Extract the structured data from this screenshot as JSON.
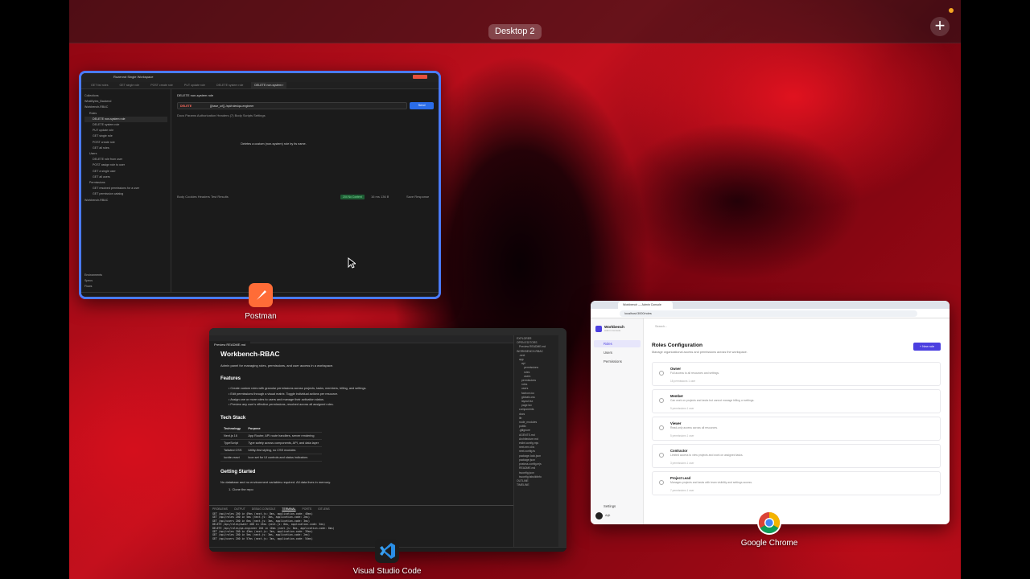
{
  "desktop": {
    "space_label": "Desktop 2",
    "add_space": "+"
  },
  "postman": {
    "app_label": "Postman",
    "workspace": "Rozenrot Single Workspace",
    "tabs": [
      "GET list roles",
      "GET single role",
      "POST create role",
      "PUT update role",
      "DELETE system role",
      "DELETE non-system r"
    ],
    "sidebar": [
      "Collections",
      "WhatBytes_Backend",
      "Workbench-RBAC",
      "Roles",
      "DELETE non-system role",
      "DELETE system role",
      "PUT update role",
      "GET single role",
      "POST create role",
      "GET all roles",
      "Users",
      "DELETE role from user",
      "POST assign role to user",
      "GET a single user",
      "GET all users",
      "Permissions",
      "GET resolved permissions for a user",
      "GET permission catalog",
      "Workbench-RBAC"
    ],
    "sidebar_bottom": [
      "Environments",
      "Specs",
      "Flows"
    ],
    "request_title": "DELETE non-system role",
    "method": "DELETE",
    "url": "{{base_url}} /api/roles/qa-engineer",
    "send": "Send",
    "req_tabs": "Docs  Params  Authorization  Headers (7)  Body  Scripts  Settings",
    "description": "Deletes a custom (non-system) role by its name.",
    "resp_tabs": "Body  Cookies  Headers  Test Results",
    "status": "204 No Content",
    "resp_meta": "16 ms   136 B",
    "save_resp": "Save Response"
  },
  "vscode": {
    "app_label": "Visual Studio Code",
    "tab": "Preview README.md",
    "title": "Workbench-RBAC",
    "intro": "Admin panel for managing roles, permissions, and user access in a workspace.",
    "features_h": "Features",
    "features": [
      "Create custom roles with granular permissions across projects, tasks, members, billing, and settings.",
      "Edit permissions through a visual matrix. Toggle individual actions per resource.",
      "Assign one or more roles to users and manage their activation status.",
      "Preview any user's effective permissions, resolved across all assigned roles."
    ],
    "stack_h": "Tech Stack",
    "stack_cols": [
      "Technology",
      "Purpose"
    ],
    "stack_rows": [
      [
        "Next.js 16",
        "App Router, API route handlers, server rendering"
      ],
      [
        "TypeScript",
        "Type safety across components, API, and data layer"
      ],
      [
        "Tailwind CSS",
        "Utility-first styling, no CSS modules"
      ],
      [
        "lucide-react",
        "Icon set for UI controls and status indicators"
      ]
    ],
    "getting_h": "Getting Started",
    "getting_p": "No database and no environment variables required. All data lives in memory.",
    "step1": "1. Clone the repo",
    "terminal_tabs": [
      "PROBLEMS",
      "OUTPUT",
      "DEBUG CONSOLE",
      "TERMINAL",
      "PORTS",
      "GITLENS"
    ],
    "terminal_lines": [
      "GET /api/roles 200 in 49ms (next.js: 8ms, application-code: 40ms)",
      "GET /api/roles 200 in 5ms (next.js: 3ms, application-code: 2ms)",
      "GET /api/users 200 in 6ms (next.js: 3ms, application-code: 3ms)",
      "DELETE /api/roles/owner 400 in 13ms (next.js: 8ms, application-code: 5ms)",
      "DELETE /api/roles/qa-engineer 204 in 16ms (next.js: 8ms, application-code: 8ms)",
      "GET /api/roles 200 in 43ms (next.js: 3ms, application-code: 39ms)",
      "GET /api/roles 200 in 5ms (next.js: 3ms, application-code: 2ms)",
      "GET /api/users 200 in 57ms (next.js: 3ms, application-code: 54ms)"
    ],
    "explorer": [
      "EXPLORER",
      "OPEN EDITORS",
      "Preview README.md",
      "WORKBENCH-RBAC",
      ".next",
      "app",
      "api",
      "permissions",
      "roles",
      "users",
      "permissions",
      "roles",
      "users",
      "favicon.ico",
      "globals.css",
      "layout.tsx",
      "page.tsx",
      "components",
      "docs",
      "lib",
      "node_modules",
      "public",
      ".gitignore",
      "AGENTS.md",
      "Architecture.md",
      "eslint.config.mjs",
      "next-env.d.ts",
      "next.config.ts",
      "package-lock.json",
      "package.json",
      "postcss.config.mjs",
      "README.md",
      "tsconfig.json",
      "tsconfig.tsbuildinfo",
      "OUTLINE",
      "TIMELINE"
    ]
  },
  "chrome": {
    "app_label": "Google Chrome",
    "tab_title": "Workbench — Admin Console",
    "address": "localhost:3000/roles",
    "brand": "Workbench",
    "brand_sub": "Admin Console",
    "search": "Search...",
    "nav": [
      "Roles",
      "Users",
      "Permissions"
    ],
    "settings": "Settings",
    "user": "Arjit",
    "page_title": "Roles Configuration",
    "page_sub": "Manage organizational access and permissions across the workspace.",
    "new_role": "+ New role",
    "roles": [
      {
        "name": "Owner",
        "desc": "Full access to all resources and settings.",
        "meta": "18 permissions   1 user"
      },
      {
        "name": "Member",
        "desc": "Can work on projects and tasks but cannot manage billing or settings.",
        "meta": "9 permissions   1 user"
      },
      {
        "name": "Viewer",
        "desc": "Read-only access across all resources.",
        "meta": "5 permissions   1 user"
      },
      {
        "name": "Contractor",
        "desc": "Limited access to view projects and work on assigned tasks.",
        "meta": "3 permissions   1 user"
      },
      {
        "name": "Project Lead",
        "desc": "Manages projects and tasks with team visibility and settings access.",
        "meta": "7 permissions   1 user"
      }
    ]
  }
}
